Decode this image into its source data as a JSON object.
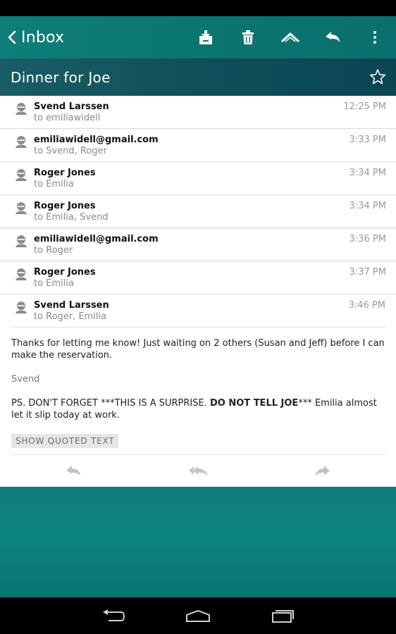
{
  "action_bar": {
    "back_label": "Inbox"
  },
  "subject": {
    "title": "Dinner for Joe"
  },
  "messages": [
    {
      "sender": "Svend Larssen",
      "recipients": "to emiliawidell",
      "time": "12:25 PM"
    },
    {
      "sender": "emiliawidell@gmail.com",
      "recipients": "to Svend, Roger",
      "time": "3:33 PM"
    },
    {
      "sender": "Roger Jones",
      "recipients": "to Emilia",
      "time": "3:34 PM"
    },
    {
      "sender": "Roger Jones",
      "recipients": "to Emilia, Svend",
      "time": "3:34 PM"
    },
    {
      "sender": "emiliawidell@gmail.com",
      "recipients": "to Roger",
      "time": "3:36 PM"
    },
    {
      "sender": "Roger Jones",
      "recipients": "to Emilia",
      "time": "3:37 PM"
    },
    {
      "sender": "Svend Larssen",
      "recipients": "to Roger, Emilia",
      "time": "3:46 PM"
    }
  ],
  "body": {
    "paragraph1": "Thanks for letting me know! Just waiting on 2 others (Susan and Jeff) before I can make the reservation.",
    "signature": "Svend",
    "ps_prefix": "PS. DON'T FORGET ***THIS IS A SURPRISE. ",
    "ps_bold": "DO NOT TELL JOE",
    "ps_suffix": "*** Emilia almost let it slip today at work."
  },
  "quoted_label": "SHOW QUOTED TEXT",
  "icons": {
    "back": "chevron-left-icon",
    "archive": "archive-icon",
    "delete": "trash-icon",
    "mark_unread": "mark-unread-icon",
    "reply": "reply-icon",
    "overflow": "overflow-menu-icon",
    "star": "star-icon"
  },
  "colors": {
    "action_bar": "#0f7e78",
    "subject_bar": "#0f4f58",
    "background_teal": "#0d8380"
  }
}
